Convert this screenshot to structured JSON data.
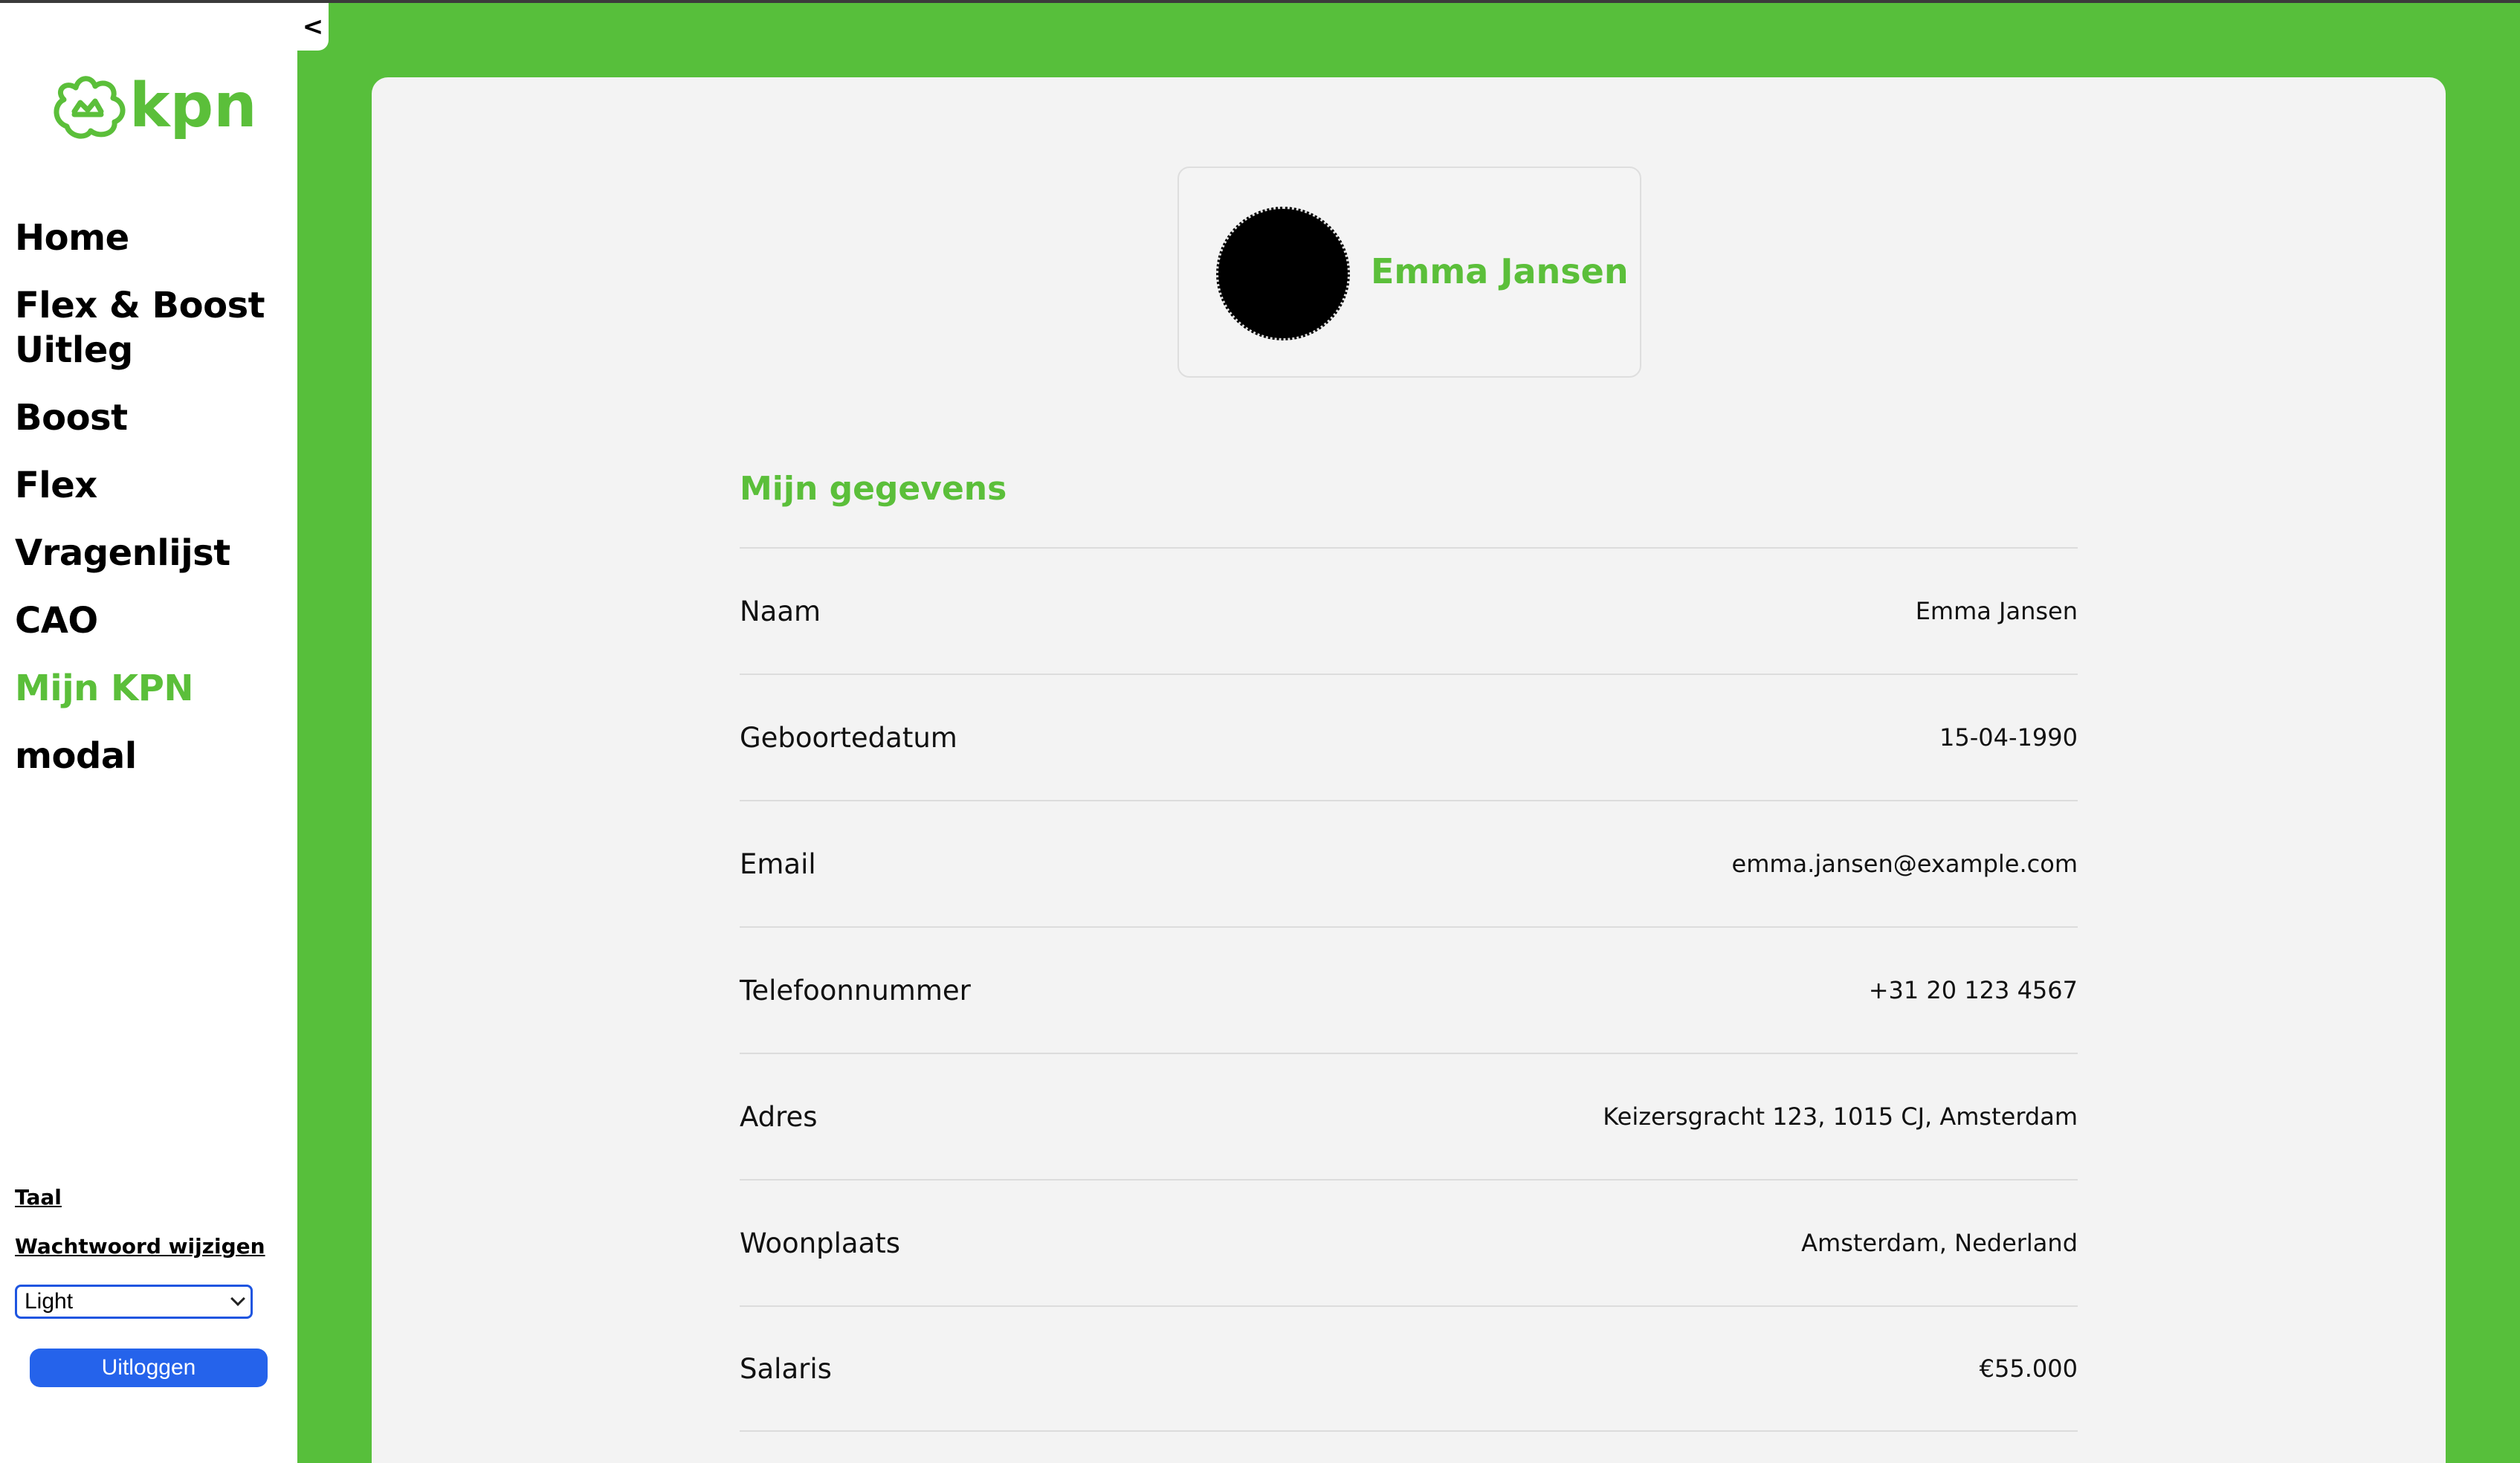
{
  "sidebar": {
    "collapse_glyph": "<",
    "logo_text": "kpn",
    "nav": [
      {
        "label": "Home"
      },
      {
        "label": "Flex & Boost Uitleg"
      },
      {
        "label": "Boost"
      },
      {
        "label": "Flex"
      },
      {
        "label": "Vragenlijst"
      },
      {
        "label": "CAO"
      },
      {
        "label": "Mijn KPN"
      },
      {
        "label": "modal"
      }
    ],
    "active_item": "Mijn KPN",
    "links": {
      "language": "Taal",
      "change_password": "Wachtwoord wijzigen"
    },
    "theme_select": {
      "selected": "Light"
    },
    "logout_label": "Uitloggen"
  },
  "profile": {
    "name": "Emma Jansen"
  },
  "section": {
    "title": "Mijn gegevens"
  },
  "details": [
    {
      "label": "Naam",
      "value": "Emma Jansen"
    },
    {
      "label": "Geboortedatum",
      "value": "15-04-1990"
    },
    {
      "label": "Email",
      "value": "emma.jansen@example.com"
    },
    {
      "label": "Telefoonnummer",
      "value": "+31 20 123 4567"
    },
    {
      "label": "Adres",
      "value": "Keizersgracht 123, 1015 CJ, Amsterdam"
    },
    {
      "label": "Woonplaats",
      "value": "Amsterdam, Nederland"
    },
    {
      "label": "Salaris",
      "value": "€55.000"
    }
  ],
  "colors": {
    "brand_green": "#5bbf3a",
    "page_green": "#57bf3b",
    "button_blue": "#2563eb"
  },
  "icons": {
    "logo": "kpn-crown-logo",
    "collapse": "chevron-left-icon",
    "select": "chevron-down-icon"
  }
}
